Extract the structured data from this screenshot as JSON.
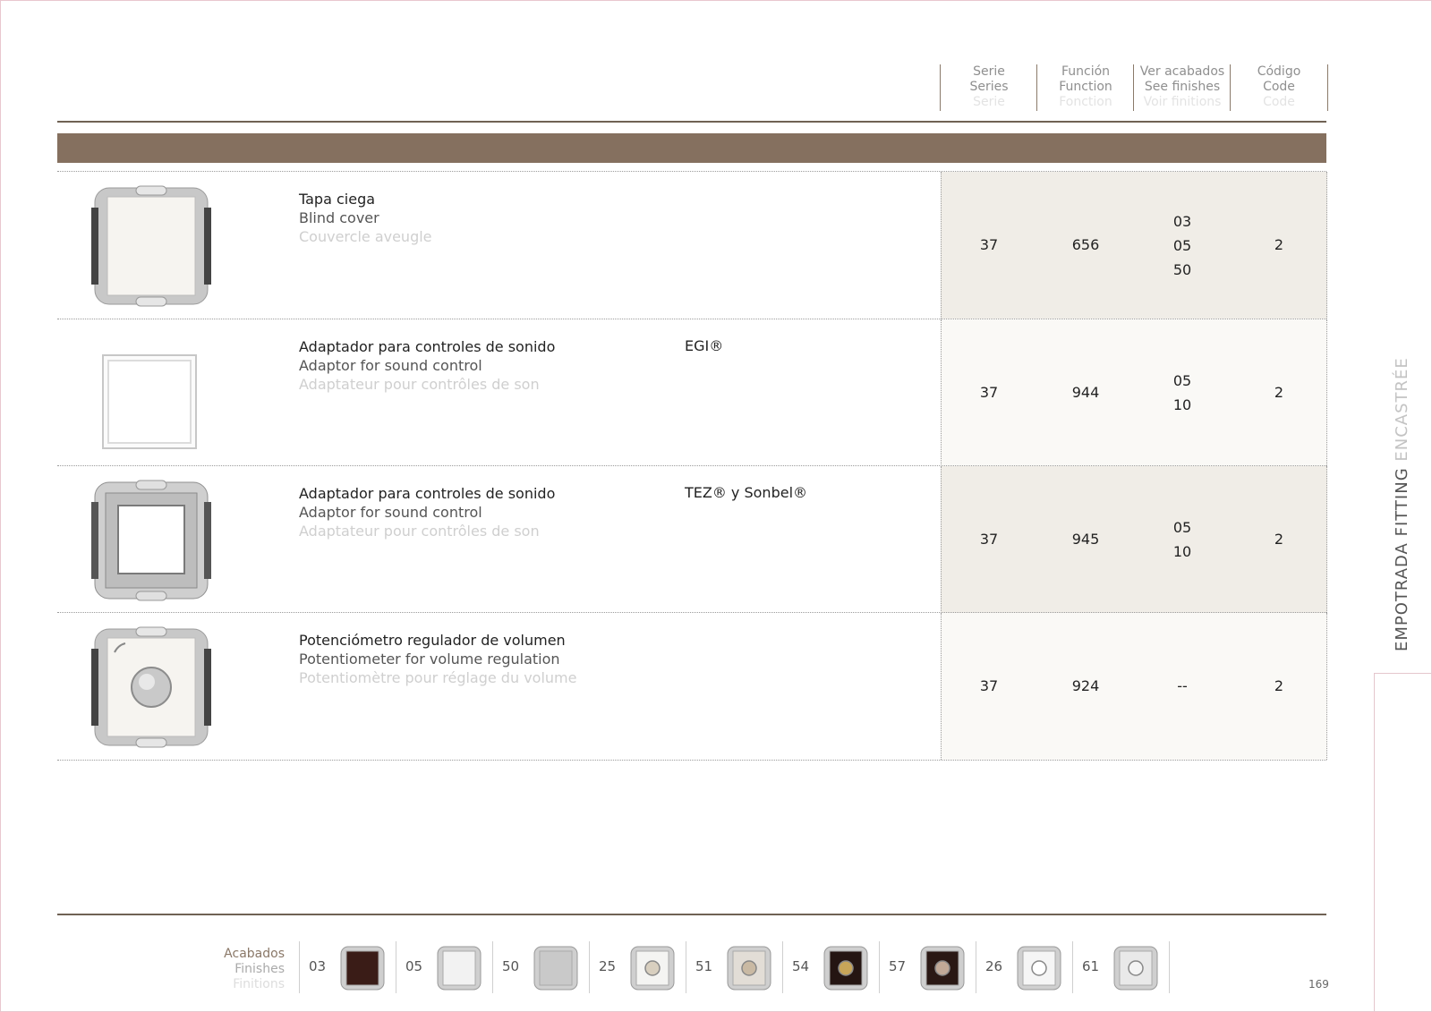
{
  "header": {
    "columns": [
      {
        "es": "Serie",
        "en": "Series",
        "fr": "Serie"
      },
      {
        "es": "Función",
        "en": "Function",
        "fr": "Fonction"
      },
      {
        "es": "Ver acabados",
        "en": "See finishes",
        "fr": "Voir finitions"
      },
      {
        "es": "Código",
        "en": "Code",
        "fr": "Code"
      }
    ]
  },
  "products": [
    {
      "es": "Tapa ciega",
      "en": "Blind cover",
      "fr": "Couvercle aveugle",
      "note": "",
      "serie": "37",
      "funcion": "656",
      "finishes": [
        "03",
        "05",
        "50"
      ],
      "codigo": "2",
      "image": "blind-cover-icon"
    },
    {
      "es": "Adaptador para controles de sonido",
      "en": "Adaptor for sound control",
      "fr": "Adaptateur pour contrôles de son",
      "note": "EGI®",
      "serie": "37",
      "funcion": "944",
      "finishes": [
        "05",
        "10"
      ],
      "codigo": "2",
      "image": "frame-adaptor-icon"
    },
    {
      "es": "Adaptador para controles de sonido",
      "en": "Adaptor for sound control",
      "fr": "Adaptateur pour contrôles de son",
      "note": "TEZ® y Sonbel®",
      "serie": "37",
      "funcion": "945",
      "finishes": [
        "05",
        "10"
      ],
      "codigo": "2",
      "image": "metal-adaptor-icon"
    },
    {
      "es": "Potenciómetro regulador de volumen",
      "en": "Potentiometer for volume regulation",
      "fr": "Potentiomètre pour réglage du volume",
      "note": "",
      "serie": "37",
      "funcion": "924",
      "finishes": [
        "--"
      ],
      "codigo": "2",
      "image": "potentiometer-icon"
    }
  ],
  "side_tab": {
    "strong": "EMPOTRADA FITTING",
    "light": " ENCASTRÉE"
  },
  "finishes_legend": {
    "es": "Acabados",
    "en": "Finishes",
    "fr": "Finitions",
    "items": [
      {
        "code": "03",
        "color": "#3a1c17",
        "knob": ""
      },
      {
        "code": "05",
        "color": "#f2f2f2",
        "knob": ""
      },
      {
        "code": "50",
        "color": "#c9c9c9",
        "knob": ""
      },
      {
        "code": "25",
        "color": "#f4f4f2",
        "knob": "#d8cfbf"
      },
      {
        "code": "51",
        "color": "#e2ddd6",
        "knob": "#c9b9a3"
      },
      {
        "code": "54",
        "color": "#241512",
        "knob": "#c7a559"
      },
      {
        "code": "57",
        "color": "#2a1814",
        "knob": "#c1a997"
      },
      {
        "code": "26",
        "color": "#f5f5f5",
        "knob": "#ffffff"
      },
      {
        "code": "61",
        "color": "#e9e9e9",
        "knob": "#f4f4f4"
      }
    ]
  },
  "page_number": "169"
}
